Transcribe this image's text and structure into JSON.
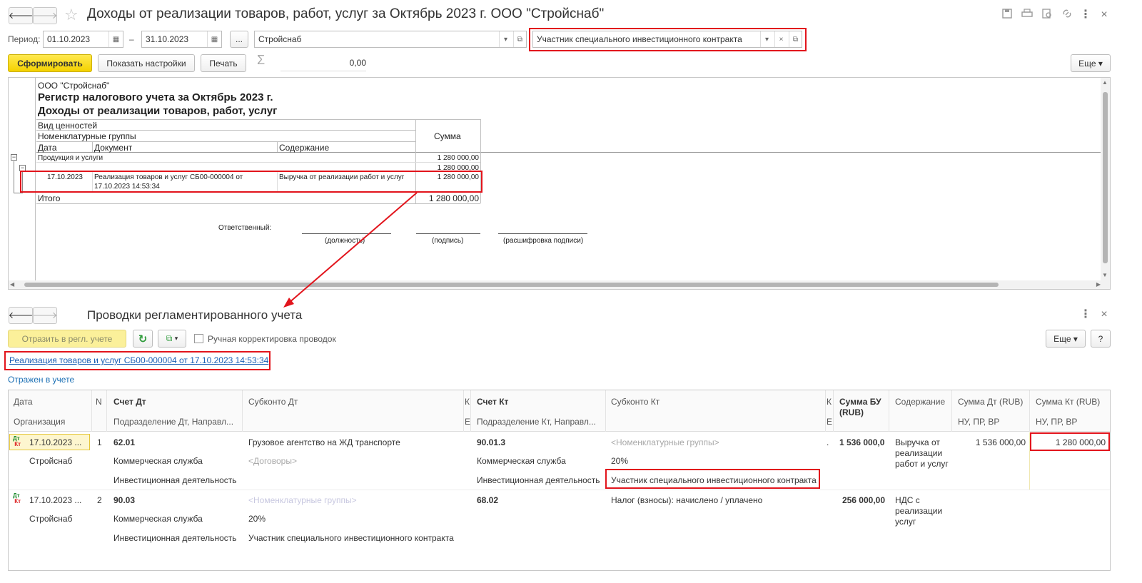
{
  "window": {
    "title": "Доходы от реализации товаров, работ, услуг за Октябрь 2023 г. ООО \"Стройснаб\""
  },
  "filters": {
    "period_label": "Период:",
    "date_from": "01.10.2023",
    "dash": "–",
    "date_to": "31.10.2023",
    "more": "...",
    "organization": "Стройснаб",
    "contract": "Участник специального инвестиционного контракта"
  },
  "toolbar": {
    "form_label": "Сформировать",
    "settings_label": "Показать настройки",
    "print_label": "Печать",
    "sigma": "Σ",
    "sum_value": "0,00",
    "more_label": "Еще"
  },
  "report": {
    "org": "ООО \"Стройснаб\"",
    "title1": "Регистр налогового учета за Октябрь 2023 г.",
    "title2": "Доходы от реализации товаров, работ, услуг",
    "hdr_kind": "Вид ценностей",
    "hdr_group": "Номенклатурные группы",
    "hdr_date": "Дата",
    "hdr_doc": "Документ",
    "hdr_content": "Содержание",
    "hdr_sum": "Сумма",
    "group_name": "Продукция и услуги",
    "group_sum": "1 280 000,00",
    "sub_sum": "1 280 000,00",
    "row_date": "17.10.2023",
    "row_doc_line1": "Реализация товаров и услуг СБ00-000004 от",
    "row_doc_line2": "17.10.2023 14:53:34",
    "row_content": "Выручка от реализации работ и услуг",
    "row_sum": "1 280 000,00",
    "total_label": "Итого",
    "total_sum": "1 280 000,00",
    "responsible": "Ответственный:",
    "sig_position": "(должность)",
    "sig_signature": "(подпись)",
    "sig_decoding": "(расшифровка подписи)"
  },
  "postings": {
    "title": "Проводки регламентированного учета",
    "reflect_label": "Отразить в регл. учете",
    "manual_label": "Ручная корректировка проводок",
    "more_label": "Еще",
    "help_label": "?",
    "doc_link": "Реализация товаров и услуг СБ00-000004 от 17.10.2023 14:53:34",
    "status": "Отражен в учете",
    "columns": {
      "date": "Дата",
      "org": "Организация",
      "n": "N",
      "dt": "Счет Дт",
      "dt_sub": "Подразделение Дт, Направл...",
      "subkonto_dt": "Субконто Дт",
      "k1": "К",
      "k1b": "Е",
      "kt": "Счет Кт",
      "kt_sub": "Подразделение Кт, Направл...",
      "subkonto_kt": "Субконто Кт",
      "k2": "К",
      "k2b": "Е",
      "sum_bu": "Сумма БУ (RUB)",
      "content": "Содержание",
      "sum_dt": "Сумма Дт (RUB)",
      "sum_dt_sub": "НУ, ПР, ВР",
      "sum_kt": "Сумма Кт (RUB)",
      "sum_kt_sub": "НУ, ПР, ВР"
    },
    "rows": [
      {
        "icon": "ДтКт",
        "date": "17.10.2023 ...",
        "n": "1",
        "org": "Стройснаб",
        "dt": "62.01",
        "dt_div": "Коммерческая служба",
        "dt_dir": "Инвестиционная деятельность",
        "subdt1": "Грузовое агентство на ЖД транспорте",
        "subdt2": "<Договоры>",
        "kt": "90.01.3",
        "kt_div": "Коммерческая служба",
        "kt_dir": "Инвестиционная деятельность",
        "subkt1": "<Номенклатурные группы>",
        "subkt2": "20%",
        "subkt3": "Участник специального инвестиционного контракта",
        "dot": ".",
        "sum_bu": "1 536 000,0",
        "content": "Выручка от реализации работ и услуг",
        "sum_dt": "1 536 000,00",
        "sum_kt": "1 280 000,00"
      },
      {
        "icon": "ДтКт",
        "date": "17.10.2023 ...",
        "n": "2",
        "org": "Стройснаб",
        "dt": "90.03",
        "dt_div": "Коммерческая служба",
        "dt_dir": "Инвестиционная деятельность",
        "subdt1": "<Номенклатурные группы>",
        "subdt2": "20%",
        "subdt3": "Участник специального инвестиционного контракта",
        "kt": "68.02",
        "subkt1": "Налог (взносы): начислено / уплачено",
        "sum_bu": "256 000,00",
        "content": "НДС с реализации услуг"
      }
    ]
  },
  "colors": {
    "highlight": "#e2141c",
    "accent_yellow": "#f4d100",
    "link": "#1a5fb4"
  }
}
